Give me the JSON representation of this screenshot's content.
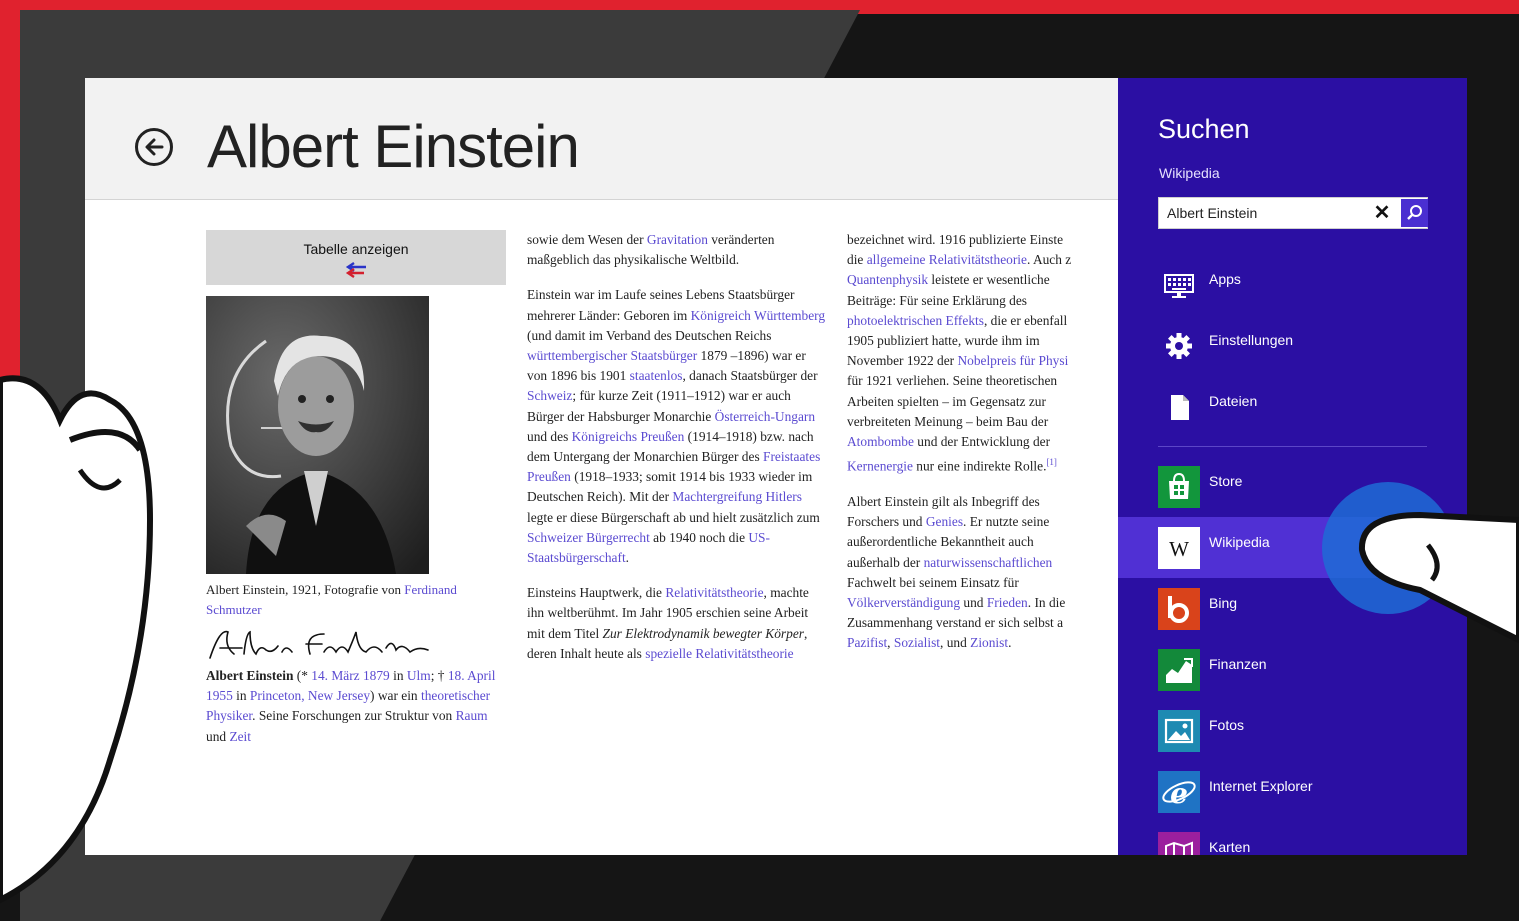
{
  "article": {
    "title": "Albert Einstein",
    "table_toggle_label": "Tabelle anzeigen",
    "caption": {
      "text": "Albert Einstein, 1921, Fotografie von ",
      "link": "Ferdinand Schmutzer"
    },
    "signature": "Albert Einstein",
    "col1": {
      "name_bold": "Albert Einstein",
      "t1": " (* ",
      "l1": "14. März 1879",
      "t2": " in ",
      "l2": "Ulm",
      "t3": "; † ",
      "l3": "18. April 1955",
      "t4": " in ",
      "l4": "Princeton, New Jersey",
      "t5": ") war ein ",
      "l5": "theoretischer Physiker",
      "t6": ". Seine Forschungen zur Struktur von ",
      "l6": "Raum",
      "t7": " und ",
      "l7": "Zeit"
    },
    "col2": {
      "p1": {
        "t1": "sowie dem Wesen der ",
        "l1": "Gravitation",
        "t2": " veränderten maßgeblich das physikalische Weltbild."
      },
      "p2": {
        "t1": "Einstein war im Laufe seines Lebens Staatsbürger mehrerer Länder: Geboren im ",
        "l1": "Königreich Württemberg",
        "t2": " (und damit im Verband des Deutschen Reichs ",
        "l2": "württembergischer Staatsbürger",
        "t3": " 1879 –1896) war er von 1896 bis 1901 ",
        "l3": "staatenlos",
        "t4": ", danach Staatsbürger der ",
        "l4": "Schweiz",
        "t5": "; für kurze Zeit (1911–1912) war er auch Bürger der Habsburger Monarchie ",
        "l5": "Österreich-Ungarn",
        "t6": " und des ",
        "l6": "Königreichs Preußen",
        "t7": " (1914–1918) bzw. nach dem Untergang der Monarchien Bürger des ",
        "l7": "Freistaates Preußen",
        "t8": " (1918–1933; somit 1914 bis 1933 wieder im Deutschen Reich). Mit der ",
        "l8": "Machtergreifung Hitlers",
        "t9": " legte er diese Bürgerschaft ab und hielt zusätzlich zum ",
        "l9": "Schweizer Bürgerrecht",
        "t10": " ab 1940 noch die ",
        "l10": "US-Staatsbürgerschaft",
        "t11": "."
      },
      "p3": {
        "t1": "Einsteins Hauptwerk, die ",
        "l1": "Relativitätstheorie",
        "t2": ", machte ihn weltberühmt. Im Jahr 1905 erschien seine Arbeit mit dem Titel ",
        "i1": "Zur Elektrodynamik bewegter Körper",
        "t3": ", deren Inhalt heute als ",
        "l2": "spezielle Relativitätstheorie"
      }
    },
    "col3": {
      "p1": {
        "t1": "bezeichnet wird. 1916 publizierte Einste",
        "t2": "die ",
        "l1": "allgemeine Relativitätstheorie",
        "t3": ". Auch z",
        "l2": "Quantenphysik",
        "t4": " leistete er wesentliche",
        "t5": "Beiträge: Für seine Erklärung des",
        "l3": "photoelektrischen Effekts",
        "t6": ", die er ebenfall",
        "t7": "1905 publiziert hatte, wurde ihm im",
        "t8": "November 1922 der ",
        "l4": "Nobelpreis für Physi",
        "t9": "für 1921 verliehen. Seine theoretischen",
        "t10": "Arbeiten spielten – im Gegensatz zur",
        "t11": "verbreiteten Meinung – beim Bau der",
        "l5": "Atombombe",
        "t12": " und der Entwicklung der",
        "l6": "Kernenergie",
        "t13": " nur eine indirekte Rolle.",
        "ref": "[1]"
      },
      "p2": {
        "t1": "Albert Einstein gilt als Inbegriff des",
        "t2": "Forschers und ",
        "l1": "Genies",
        "t3": ". Er nutzte seine",
        "t4": "außerordentliche Bekanntheit auch",
        "t5": "außerhalb der ",
        "l2": "naturwissenschaftlichen",
        "t6": "Fachwelt bei seinem Einsatz für",
        "l3": "Völkerverständigung",
        "t7": " und ",
        "l4": "Frieden",
        "t8": ". In die",
        "t9": "Zusammenhang verstand er sich selbst a",
        "l5": "Pazifist",
        "t10": ", ",
        "l6": "Sozialist",
        "t11": ", und ",
        "l7": "Zionist",
        "t12": "."
      }
    }
  },
  "charm": {
    "title": "Suchen",
    "scope": "Wikipedia",
    "query": "Albert Einstein",
    "items": [
      {
        "label": "Apps",
        "icon": "keyboard-icon",
        "color": "#2b0fa3"
      },
      {
        "label": "Einstellungen",
        "icon": "gear-icon",
        "color": "#2b0fa3"
      },
      {
        "label": "Dateien",
        "icon": "file-icon",
        "color": "#2b0fa3"
      },
      {
        "label": "Store",
        "icon": "store-icon",
        "color": "#12963c"
      },
      {
        "label": "Wikipedia",
        "icon": "wikipedia-icon",
        "color": "#ffffff",
        "selected": true
      },
      {
        "label": "Bing",
        "icon": "bing-icon",
        "color": "#d9431b"
      },
      {
        "label": "Finanzen",
        "icon": "finance-icon",
        "color": "#13893a"
      },
      {
        "label": "Fotos",
        "icon": "photos-icon",
        "color": "#1e8ab2"
      },
      {
        "label": "Internet Explorer",
        "icon": "ie-icon",
        "color": "#1f73c4"
      },
      {
        "label": "Karten",
        "icon": "maps-icon",
        "color": "#9b1f9e"
      }
    ]
  },
  "colors": {
    "accent": "#2b0fa3",
    "selected": "#5030d4",
    "link": "#5b4bd1",
    "frame_red": "#e0222e"
  }
}
